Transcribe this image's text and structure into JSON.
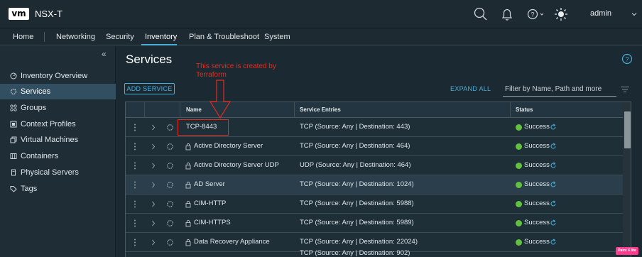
{
  "app": {
    "logo": "vm",
    "title": "NSX-T",
    "user": "admin"
  },
  "nav": {
    "items": [
      "Home",
      "Networking",
      "Security",
      "Inventory",
      "Plan & Troubleshoot",
      "System"
    ],
    "active": "Inventory"
  },
  "sidebar": {
    "collapse_glyph": "«",
    "items": [
      {
        "label": "Inventory Overview",
        "icon": "dashboard-icon"
      },
      {
        "label": "Services",
        "icon": "services-icon",
        "active": true
      },
      {
        "label": "Groups",
        "icon": "groups-icon"
      },
      {
        "label": "Context Profiles",
        "icon": "context-profiles-icon"
      },
      {
        "label": "Virtual Machines",
        "icon": "virtual-machines-icon"
      },
      {
        "label": "Containers",
        "icon": "containers-icon"
      },
      {
        "label": "Physical Servers",
        "icon": "physical-servers-icon"
      },
      {
        "label": "Tags",
        "icon": "tag-icon"
      }
    ]
  },
  "main": {
    "title": "Services",
    "annotation": "This service is created by Terraform",
    "add_button": "ADD SERVICE",
    "expand_all": "EXPAND ALL",
    "filter_placeholder": "Filter by Name, Path and more",
    "columns": {
      "name": "Name",
      "entries": "Service Entries",
      "status": "Status"
    },
    "rows": [
      {
        "name": "TCP-8443",
        "locked": false,
        "entries": [
          "TCP (Source: Any | Destination: 443)"
        ],
        "status": "Success",
        "highlight": false
      },
      {
        "name": "Active Directory Server",
        "locked": true,
        "entries": [
          "TCP (Source: Any | Destination: 464)"
        ],
        "status": "Success",
        "highlight": false
      },
      {
        "name": "Active Directory Server UDP",
        "locked": true,
        "entries": [
          "UDP (Source: Any | Destination: 464)"
        ],
        "status": "Success",
        "highlight": false
      },
      {
        "name": "AD Server",
        "locked": true,
        "entries": [
          "TCP (Source: Any | Destination: 1024)"
        ],
        "status": "Success",
        "highlight": true
      },
      {
        "name": "CIM-HTTP",
        "locked": true,
        "entries": [
          "TCP (Source: Any | Destination: 5988)"
        ],
        "status": "Success",
        "highlight": false
      },
      {
        "name": "CIM-HTTPS",
        "locked": true,
        "entries": [
          "TCP (Source: Any | Destination: 5989)"
        ],
        "status": "Success",
        "highlight": false
      },
      {
        "name": "Data Recovery Appliance",
        "locked": true,
        "entries": [
          "TCP (Source: Any | Destination: 22024)",
          "TCP (Source: Any | Destination: 902)"
        ],
        "status": "Success",
        "highlight": false
      }
    ]
  },
  "colors": {
    "accent": "#49afd9",
    "success": "#62c23f",
    "annotation": "#e62b1e",
    "background": "#1b2a32"
  },
  "badge": "Paint X lite"
}
